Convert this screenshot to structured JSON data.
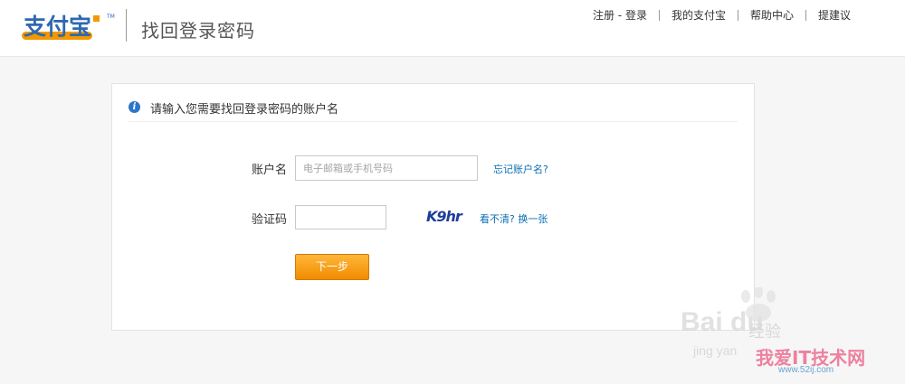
{
  "header": {
    "logo_text": "支付宝",
    "page_title": "找回登录密码",
    "nav": {
      "register_login": "注册 - 登录",
      "my_alipay": "我的支付宝",
      "help_center": "帮助中心",
      "feedback": "提建议"
    }
  },
  "form": {
    "notice": "请输入您需要找回登录密码的账户名",
    "account_label": "账户名",
    "account_placeholder": "电子邮箱或手机号码",
    "account_value": "",
    "forgot_account_link": "忘记账户名?",
    "captcha_label": "验证码",
    "captcha_value": "",
    "captcha_image_text": "K9hr",
    "refresh_captcha_link": "看不清? 换一张",
    "next_button": "下一步"
  },
  "watermark": {
    "baidu": "Bai du",
    "jingyan": "经验",
    "jingyan_pinyin": "jing yan",
    "site_name": "我爱IT技术网",
    "site_url": "www.52ij.com"
  },
  "colors": {
    "brand_orange": "#f18c00",
    "link_blue": "#0b6fb3",
    "logo_blue": "#2e68b1"
  }
}
